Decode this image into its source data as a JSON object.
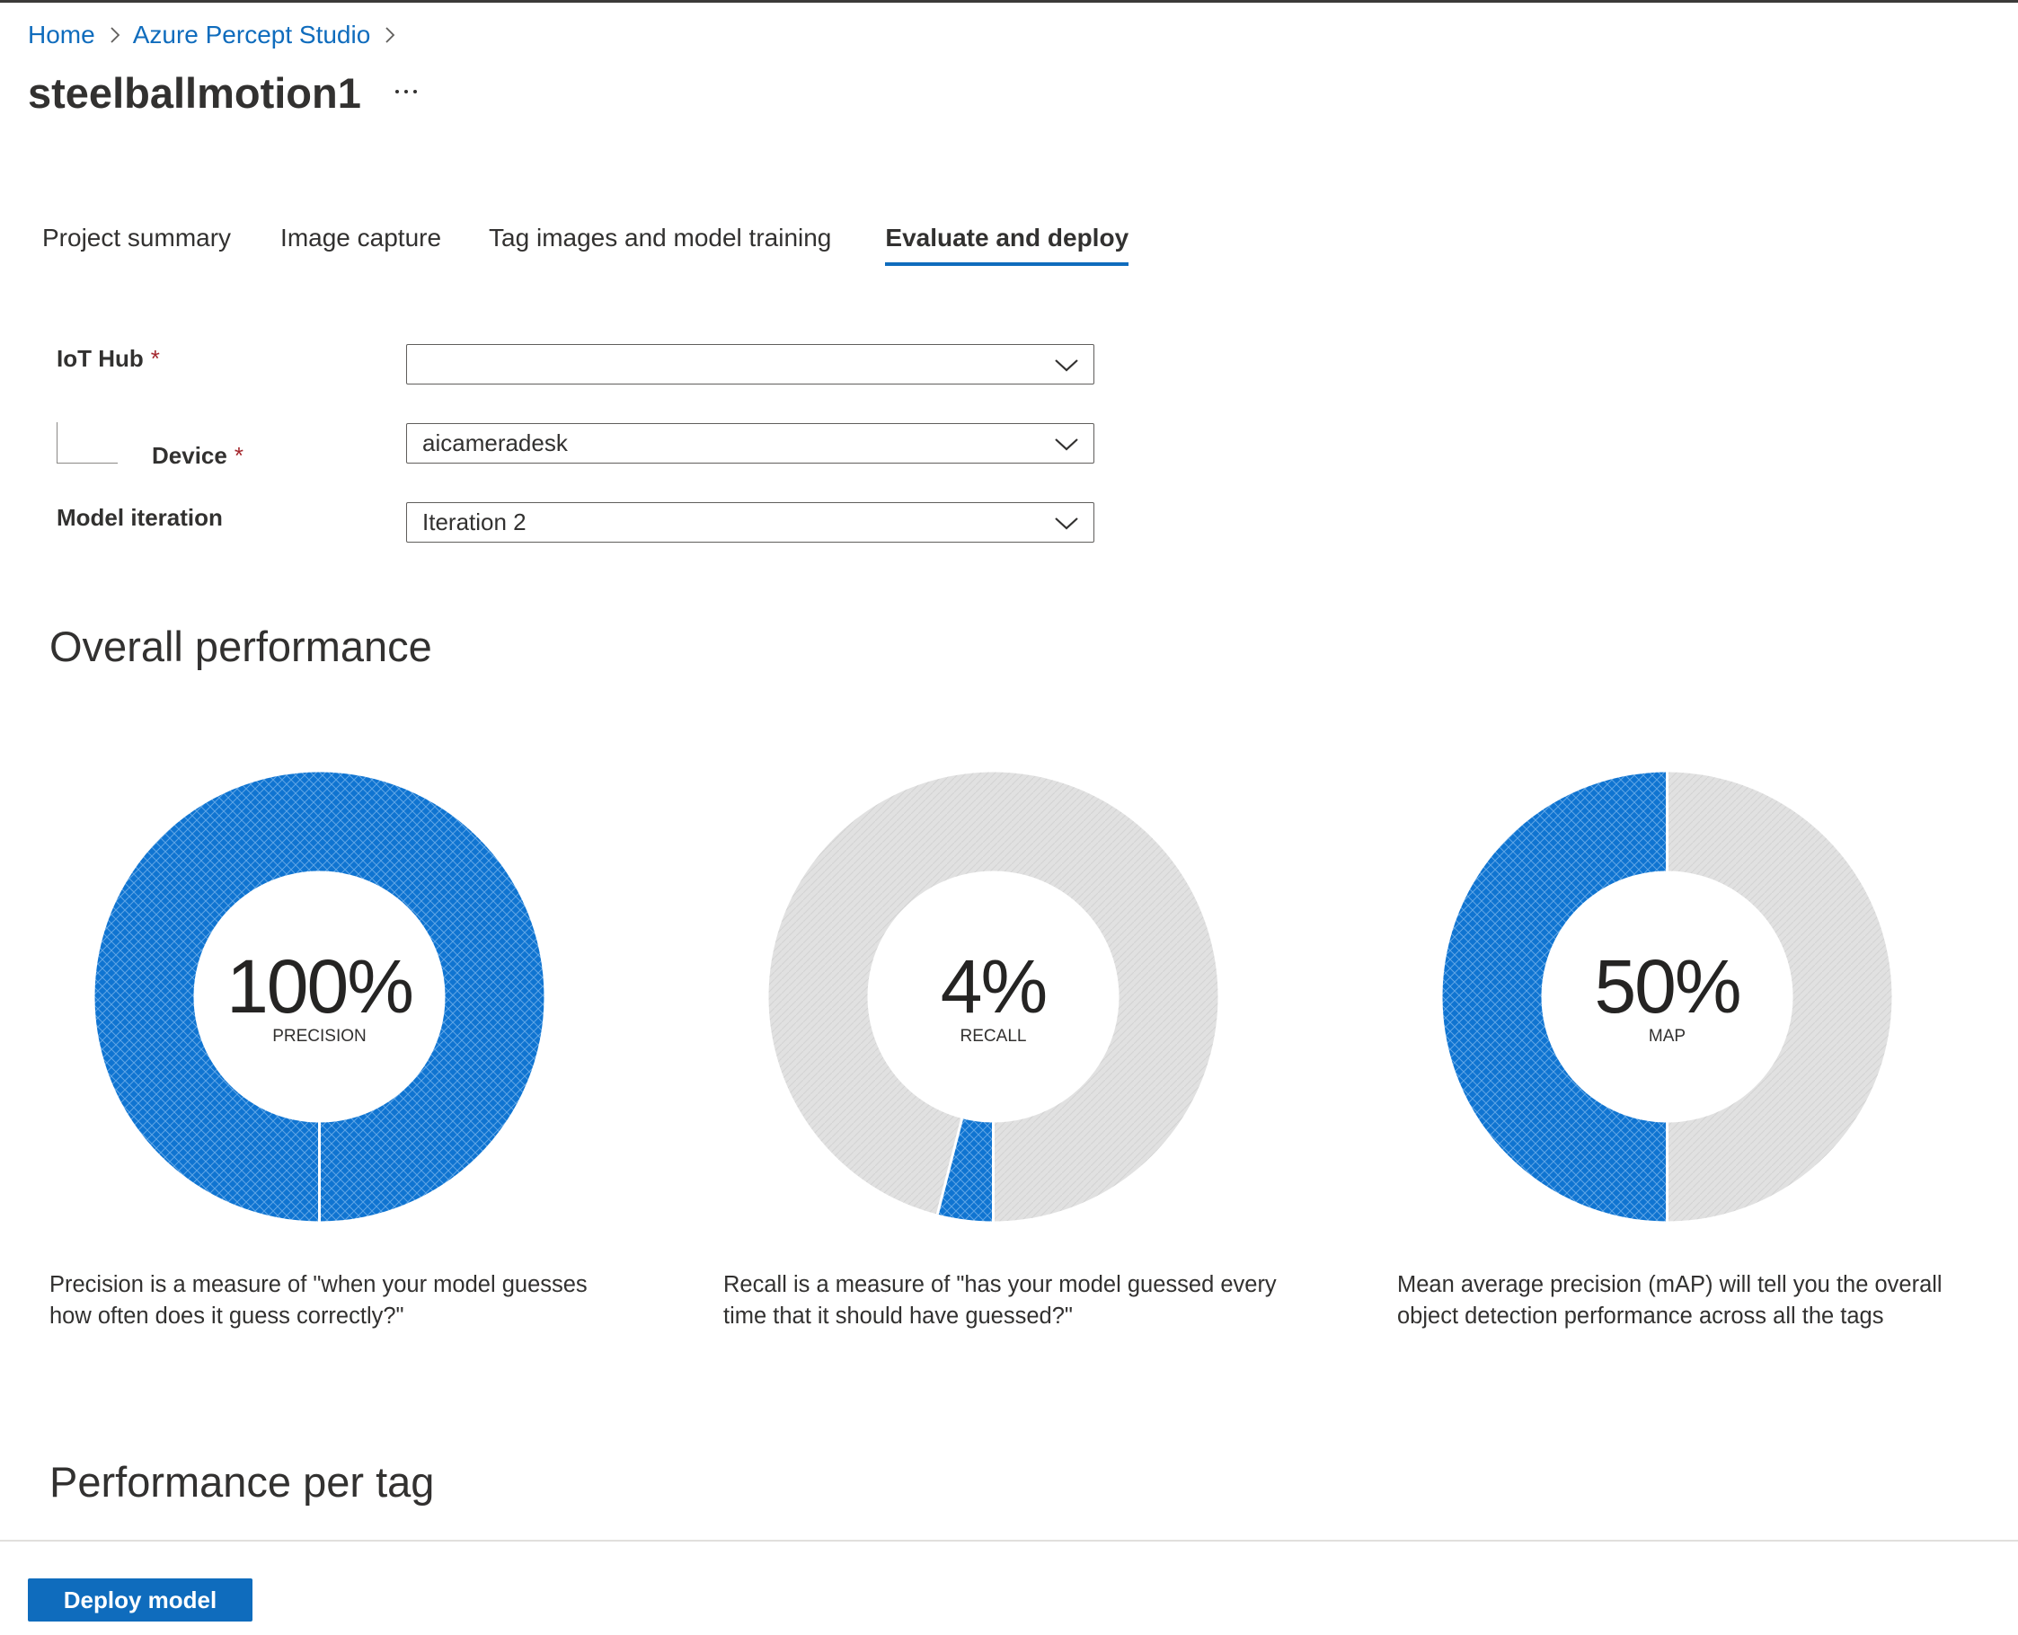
{
  "breadcrumb": {
    "items": [
      "Home",
      "Azure Percept Studio"
    ]
  },
  "page": {
    "title": "steelballmotion1",
    "more_label": "···"
  },
  "tabs": [
    {
      "label": "Project summary",
      "active": false
    },
    {
      "label": "Image capture",
      "active": false
    },
    {
      "label": "Tag images and model training",
      "active": false
    },
    {
      "label": "Evaluate and deploy",
      "active": true
    }
  ],
  "form": {
    "required_marker": "*",
    "iot_hub": {
      "label": "IoT Hub",
      "value": ""
    },
    "device": {
      "label": "Device",
      "value": "aicameradesk"
    },
    "model_iteration": {
      "label": "Model iteration",
      "value": "Iteration 2"
    }
  },
  "overall_performance": {
    "heading": "Overall performance",
    "metrics": [
      {
        "value_text": "100%",
        "label": "PRECISION",
        "fraction": 1.0,
        "description": "Precision is a measure of \"when your model guesses how often does it guess correctly?\""
      },
      {
        "value_text": "4%",
        "label": "RECALL",
        "fraction": 0.04,
        "description": "Recall is a measure of \"has your model guessed every time that it should have guessed?\""
      },
      {
        "value_text": "50%",
        "label": "MAP",
        "fraction": 0.5,
        "description": "Mean average precision (mAP) will tell you the overall object detection performance across all the tags"
      }
    ]
  },
  "performance_per_tag": {
    "heading": "Performance per tag"
  },
  "footer": {
    "deploy_label": "Deploy model"
  },
  "colors": {
    "accent": "#0f6cbd",
    "donut_fill": "#0f74d1",
    "donut_empty": "#e1e1e1",
    "required": "#a4262c"
  }
}
